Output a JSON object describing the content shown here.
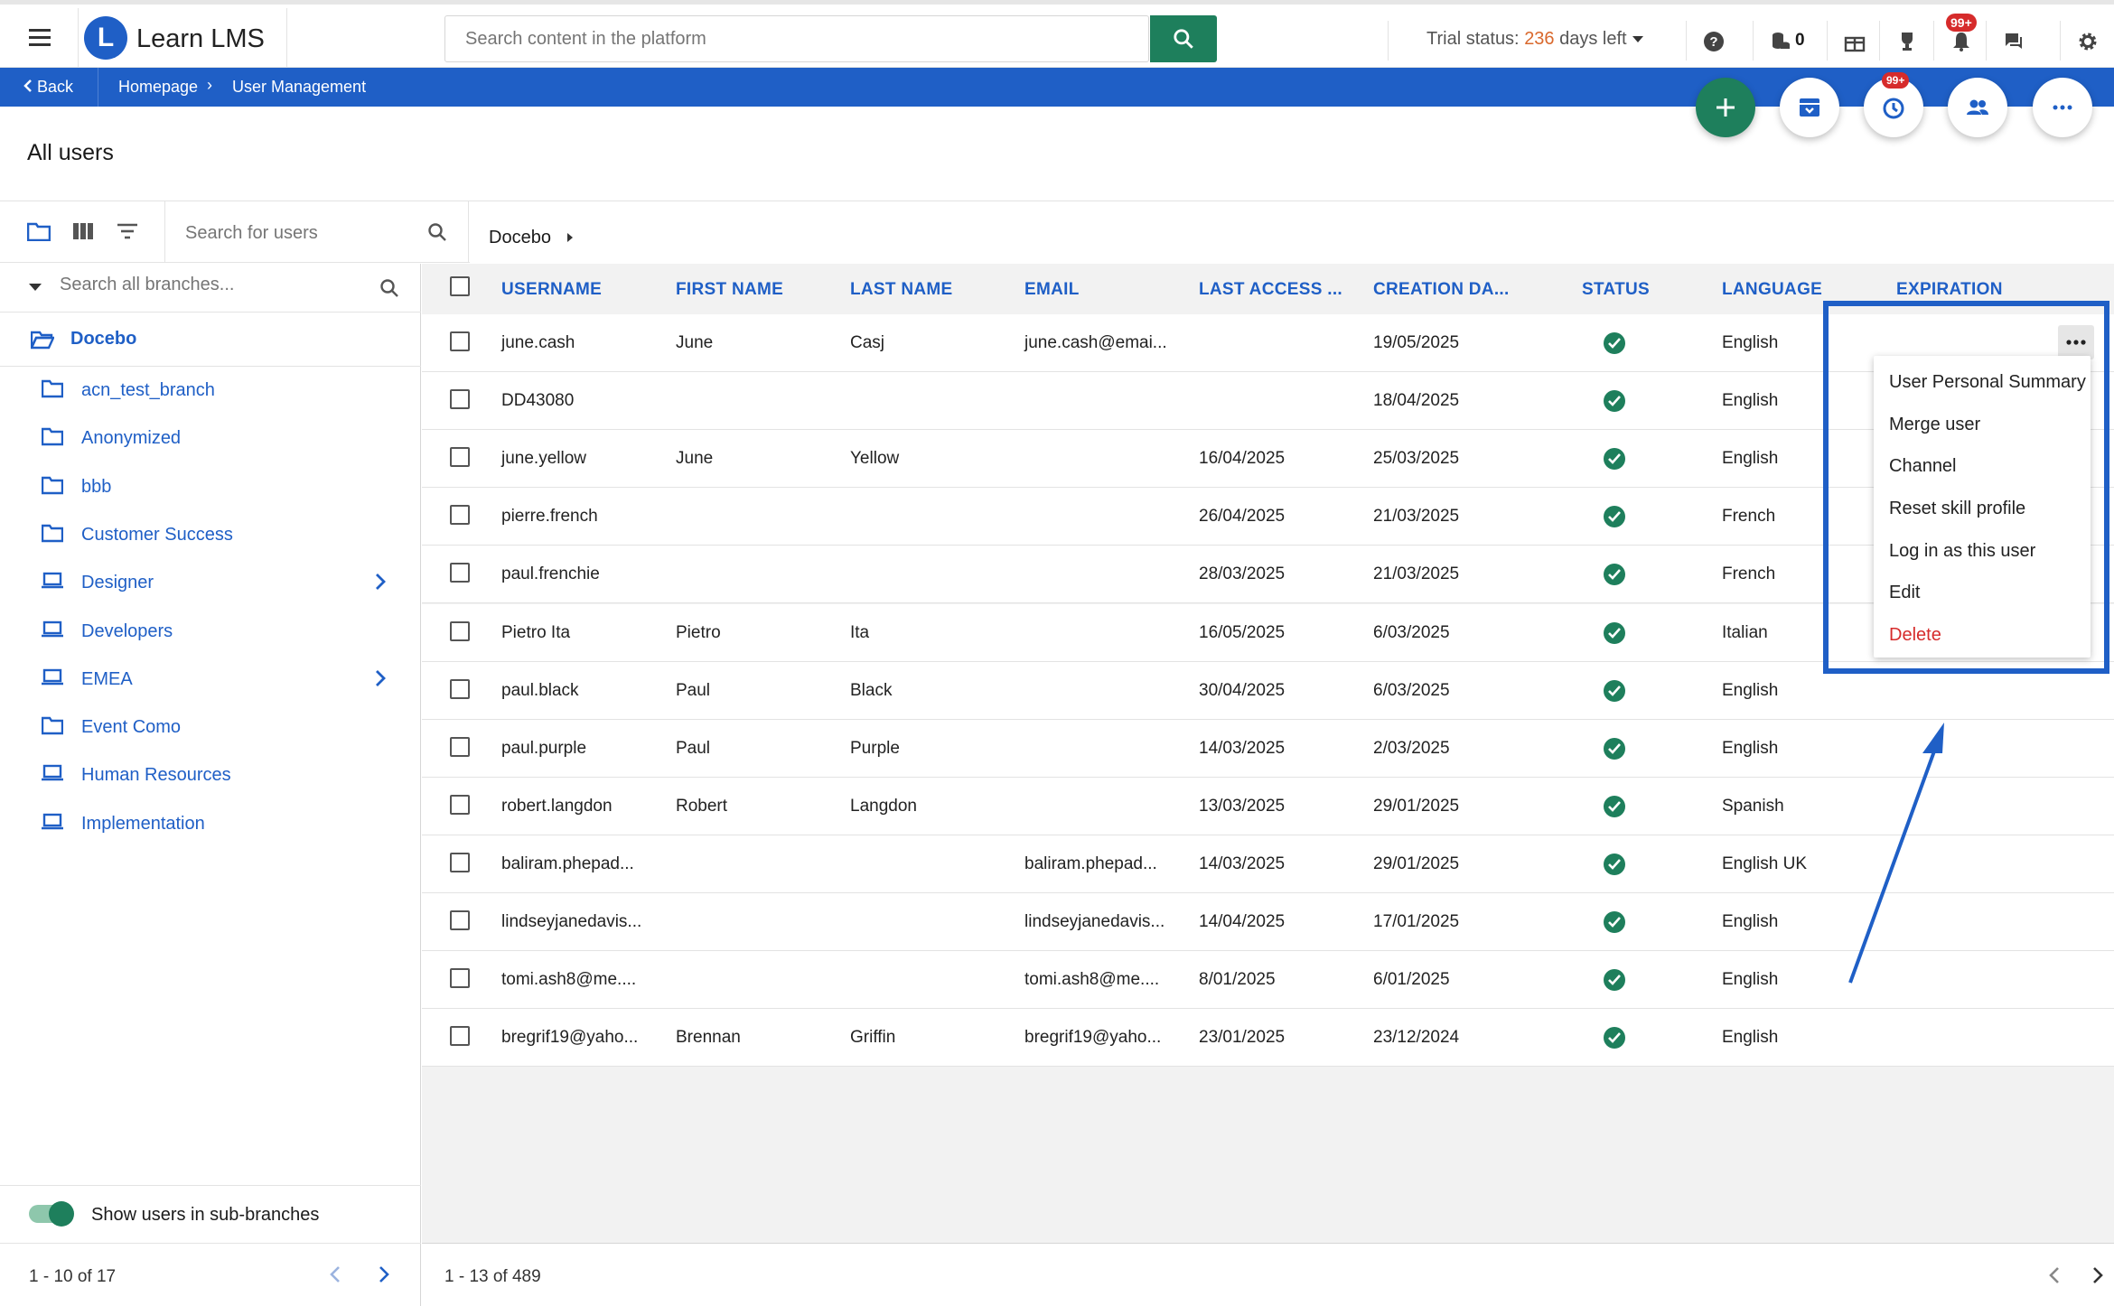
{
  "app": {
    "name": "Learn LMS",
    "logo_letter": "L"
  },
  "search": {
    "placeholder": "Search content in the platform"
  },
  "trial": {
    "label": "Trial status:",
    "days": "236",
    "suffix": "days left"
  },
  "top_icons": {
    "coins_count": "0",
    "notifications_badge": "99+"
  },
  "breadcrumb": {
    "back": "Back",
    "home": "Homepage",
    "current": "User Management"
  },
  "fab": {
    "history_badge": "99+"
  },
  "page": {
    "title": "All users"
  },
  "left": {
    "user_search_placeholder": "Search for users",
    "branch_search_placeholder": "Search all branches...",
    "root": "Docebo",
    "branches": [
      {
        "label": "acn_test_branch",
        "icon": "folder-icon",
        "has_children": false
      },
      {
        "label": "Anonymized",
        "icon": "folder-icon",
        "has_children": false
      },
      {
        "label": "bbb",
        "icon": "folder-icon",
        "has_children": false
      },
      {
        "label": "Customer Success",
        "icon": "folder-icon",
        "has_children": false
      },
      {
        "label": "Designer",
        "icon": "laptop-icon",
        "has_children": true
      },
      {
        "label": "Developers",
        "icon": "laptop-icon",
        "has_children": false
      },
      {
        "label": "EMEA",
        "icon": "laptop-icon",
        "has_children": true
      },
      {
        "label": "Event Como",
        "icon": "folder-icon",
        "has_children": false
      },
      {
        "label": "Human Resources",
        "icon": "laptop-icon",
        "has_children": false
      },
      {
        "label": "Implementation",
        "icon": "laptop-icon",
        "has_children": false
      }
    ],
    "toggle_label": "Show users in sub-branches",
    "pager": "1 - 10 of 17"
  },
  "table": {
    "branch_crumb": "Docebo",
    "headers": [
      "USERNAME",
      "FIRST NAME",
      "LAST NAME",
      "EMAIL",
      "LAST ACCESS ...",
      "CREATION DA...",
      "STATUS",
      "LANGUAGE",
      "EXPIRATION"
    ],
    "rows": [
      {
        "username": "june.cash",
        "first": "June",
        "last": "Casj",
        "email": "june.cash@emai...",
        "last_access": "",
        "created": "19/05/2025",
        "language": "English"
      },
      {
        "username": "DD43080",
        "first": "",
        "last": "",
        "email": "",
        "last_access": "",
        "created": "18/04/2025",
        "language": "English"
      },
      {
        "username": "june.yellow",
        "first": "June",
        "last": "Yellow",
        "email": "",
        "last_access": "16/04/2025",
        "created": "25/03/2025",
        "language": "English"
      },
      {
        "username": "pierre.french",
        "first": "",
        "last": "",
        "email": "",
        "last_access": "26/04/2025",
        "created": "21/03/2025",
        "language": "French"
      },
      {
        "username": "paul.frenchie",
        "first": "",
        "last": "",
        "email": "",
        "last_access": "28/03/2025",
        "created": "21/03/2025",
        "language": "French"
      },
      {
        "username": "Pietro Ita",
        "first": "Pietro",
        "last": "Ita",
        "email": "",
        "last_access": "16/05/2025",
        "created": "6/03/2025",
        "language": "Italian"
      },
      {
        "username": "paul.black",
        "first": "Paul",
        "last": "Black",
        "email": "",
        "last_access": "30/04/2025",
        "created": "6/03/2025",
        "language": "English"
      },
      {
        "username": "paul.purple",
        "first": "Paul",
        "last": "Purple",
        "email": "",
        "last_access": "14/03/2025",
        "created": "2/03/2025",
        "language": "English"
      },
      {
        "username": "robert.langdon",
        "first": "Robert",
        "last": "Langdon",
        "email": "",
        "last_access": "13/03/2025",
        "created": "29/01/2025",
        "language": "Spanish"
      },
      {
        "username": "baliram.phepad...",
        "first": "",
        "last": "",
        "email": "baliram.phepad...",
        "last_access": "14/03/2025",
        "created": "29/01/2025",
        "language": "English UK"
      },
      {
        "username": "lindseyjanedavis...",
        "first": "",
        "last": "",
        "email": "lindseyjanedavis...",
        "last_access": "14/04/2025",
        "created": "17/01/2025",
        "language": "English"
      },
      {
        "username": "tomi.ash8@me....",
        "first": "",
        "last": "",
        "email": "tomi.ash8@me....",
        "last_access": "8/01/2025",
        "created": "6/01/2025",
        "language": "English"
      },
      {
        "username": "bregrif19@yaho...",
        "first": "Brennan",
        "last": "Griffin",
        "email": "bregrif19@yaho...",
        "last_access": "23/01/2025",
        "created": "23/12/2024",
        "language": "English"
      }
    ],
    "pager": "1 - 13 of 489"
  },
  "context_menu": {
    "items": [
      "User Personal Summary",
      "Merge user",
      "Channel",
      "Reset skill profile",
      "Log in as this user",
      "Edit"
    ],
    "danger_item": "Delete"
  },
  "colors": {
    "primary": "#1f5fc6",
    "accent_green": "#1e7f5c",
    "trial_days": "#d9682c",
    "danger": "#d62b2b"
  }
}
